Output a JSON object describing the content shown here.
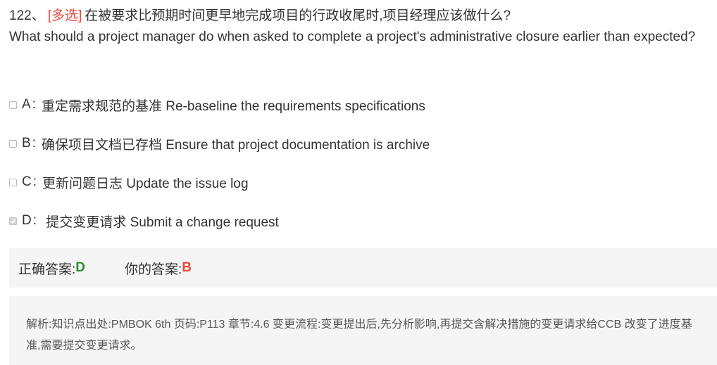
{
  "question": {
    "number": "122、",
    "type_tag": "[多选]",
    "text_cn": "在被要求比预期时间更早地完成项目的行政收尾时,项目经理应该做什么?",
    "text_en": "What should a project manager do when asked to complete a project's administrative closure earlier than expected?"
  },
  "options": [
    {
      "letter": "A",
      "sep": ":",
      "text": "重定需求规范的基准 Re-baseline the requirements specifications",
      "checked": false
    },
    {
      "letter": "B",
      "sep": ":",
      "text": "确保项目文档已存档 Ensure that project documentation is archive",
      "checked": false
    },
    {
      "letter": "C",
      "sep": ":",
      "text": "更新问题日志 Update the issue log",
      "checked": false
    },
    {
      "letter": "D",
      "sep": ":",
      "text": " 提交变更请求 Submit a change request",
      "checked": true
    }
  ],
  "answers": {
    "correct_label": "正确答案:",
    "correct_value": "D",
    "mine_label": "你的答案:",
    "mine_value": "B"
  },
  "analysis": {
    "text": "解析:知识点出处:PMBOK 6th 页码:P113 章节:4.6 变更流程:变更提出后,先分析影响,再提交含解决措施的变更请求给CCB 改变了进度基准,需要提交变更请求。"
  },
  "colors": {
    "type_tag": "#e8453c",
    "correct": "#2e8b2e",
    "wrong": "#e8453c",
    "panel_bg": "#f5f5f5"
  }
}
